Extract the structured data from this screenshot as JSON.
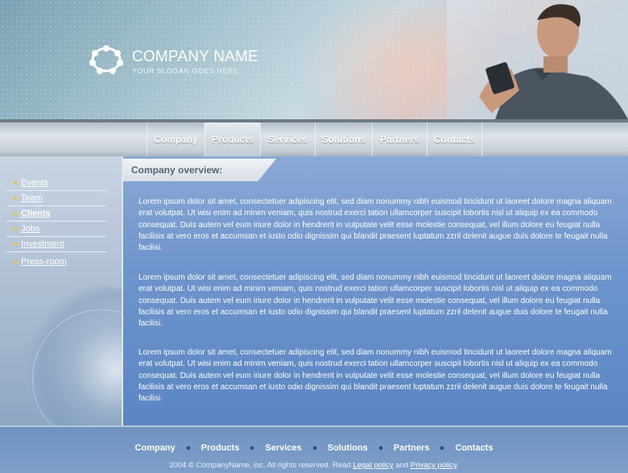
{
  "header": {
    "company_name": "COMPANY NAME",
    "slogan": "YOUR SLOGAN GOES HERE"
  },
  "nav": {
    "items": [
      {
        "label": "Company",
        "active": false
      },
      {
        "label": "Products",
        "active": true
      },
      {
        "label": "Services",
        "active": false
      },
      {
        "label": "Solutions",
        "active": false
      },
      {
        "label": "Partners",
        "active": false
      },
      {
        "label": "Contacts",
        "active": false
      }
    ]
  },
  "sidebar": {
    "items": [
      {
        "label": "Events"
      },
      {
        "label": "Team"
      },
      {
        "label": "Clients",
        "bold": true
      },
      {
        "label": "Jobs"
      },
      {
        "label": "Investment"
      },
      {
        "label": "Press-room"
      }
    ]
  },
  "main": {
    "section_title": "Company overview:",
    "paragraphs": [
      "Lorem ipsum dolor sit amet, consectetuer adipiscing elit, sed diam nonummy nibh euismod tincidunt ut laoreet dolore magna aliquam erat volutpat. Ut wisi enim ad minim veniam, quis nostrud exerci tation ullamcorper suscipit lobortis nisl ut aliquip ex ea commodo consequat. Duis autem vel eum iriure dolor in hendrerit in vulputate velit esse molestie consequat, vel illum dolore eu feugiat nulla facilisis at vero eros et accumsan et iusto odio dignissim qui blandit praesent luptatum zzril delenit augue duis dolore te feugait nulla facilisi.",
      "Lorem ipsum dolor sit amet, consectetuer adipiscing elit, sed diam nonummy nibh euismod tincidunt ut laoreet dolore magna aliquam erat volutpat. Ut wisi enim ad minim veniam, quis nostrud exerci tation ullamcorper suscipit lobortis nisl ut aliquip ex ea commodo consequat. Duis autem vel eum iriure dolor in hendrerit in vulputate velit esse molestie consequat, vel illum dolore eu feugiat nulla facilisis at vero eros et accumsan et iusto odio dignissim qui blandit praesent luptatum zzril delenit augue duis dolore te feugait nulla facilisi.",
      "Lorem ipsum dolor sit amet, consectetuer adipiscing elit, sed diam nonummy nibh euismod tincidunt ut laoreet dolore magna aliquam erat volutpat. Ut wisi enim ad minim veniam, quis nostrud exerci tation ullamcorper suscipit lobortis nisl ut aliquip ex ea commodo consequat. Duis autem vel eum iriure dolor in hendrerit in vulputate velit esse molestie consequat, vel illum dolore eu feugiat nulla facilisis at vero eros et accumsan et iusto odio dignissim qui blandit praesent luptatum zzril delenit augue duis dolore te feugait nulla facilisi."
    ]
  },
  "footer": {
    "nav": [
      "Company",
      "Products",
      "Services",
      "Solutions",
      "Partners",
      "Contacts"
    ],
    "copyright_prefix": "2004 © CompanyName, inc. All rights reserved. Read",
    "legal_link": "Legal policy",
    "and_text": "and",
    "privacy_link": "Privacy policy",
    "period": "."
  },
  "colors": {
    "main_blue": "#5a86c4",
    "bullet": "#e5c34a"
  }
}
